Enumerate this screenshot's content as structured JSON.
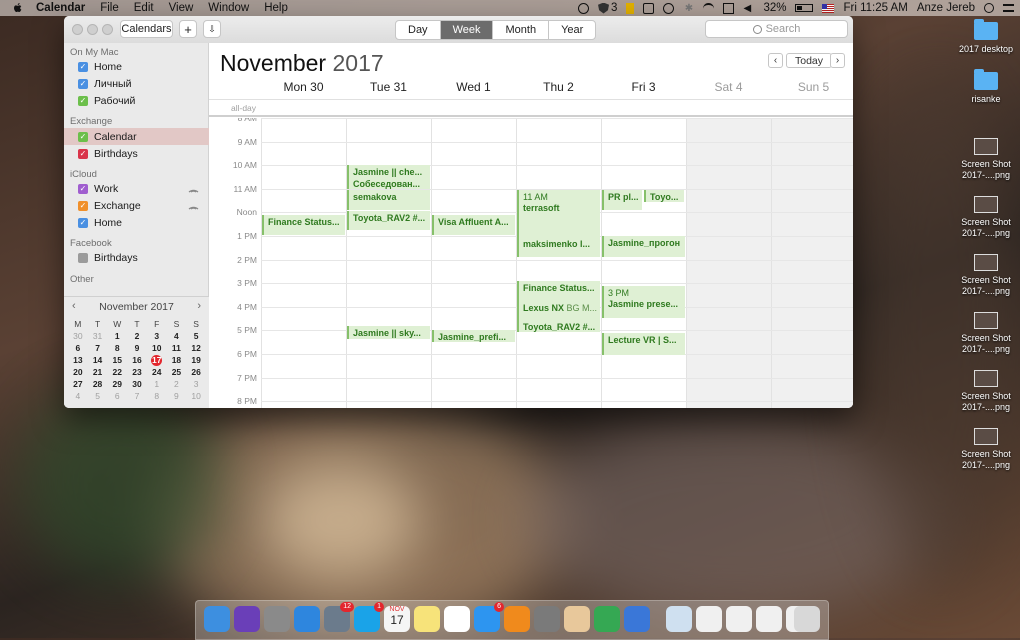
{
  "menubar": {
    "app": "Calendar",
    "items": [
      "File",
      "Edit",
      "View",
      "Window",
      "Help"
    ],
    "badge_count": "3",
    "battery": "32%",
    "clock": "Fri 11:25 AM",
    "user": "Anze Jereb"
  },
  "toolbar": {
    "calendars_label": "Calendars",
    "add_label": "+",
    "views": [
      "Day",
      "Week",
      "Month",
      "Year"
    ],
    "active_view": "Week",
    "search_placeholder": "Search",
    "today_label": "Today"
  },
  "sidebar": {
    "sections": [
      {
        "title": "On My Mac",
        "items": [
          {
            "label": "Home",
            "color": "#4a90e2"
          },
          {
            "label": "Личный",
            "color": "#4a90e2"
          },
          {
            "label": "Рабочий",
            "color": "#6cbf4b"
          }
        ]
      },
      {
        "title": "Exchange",
        "items": [
          {
            "label": "Calendar",
            "color": "#6cbf4b"
          },
          {
            "label": "Birthdays",
            "color": "#d9344a"
          }
        ]
      },
      {
        "title": "iCloud",
        "items": [
          {
            "label": "Work",
            "color": "#a05ecf"
          },
          {
            "label": "Exchange",
            "color": "#f0902b"
          },
          {
            "label": "Home",
            "color": "#4a90e2"
          }
        ]
      },
      {
        "title": "Facebook",
        "items": [
          {
            "label": "Birthdays",
            "color": "#9b9b9b"
          }
        ]
      },
      {
        "title": "Other",
        "items": []
      }
    ]
  },
  "minical": {
    "title": "November 2017",
    "dow": [
      "M",
      "T",
      "W",
      "T",
      "F",
      "S",
      "S"
    ],
    "weeks": [
      [
        "30",
        "31",
        "1",
        "2",
        "3",
        "4",
        "5"
      ],
      [
        "6",
        "7",
        "8",
        "9",
        "10",
        "11",
        "12"
      ],
      [
        "13",
        "14",
        "15",
        "16",
        "17",
        "18",
        "19"
      ],
      [
        "20",
        "21",
        "22",
        "23",
        "24",
        "25",
        "26"
      ],
      [
        "27",
        "28",
        "29",
        "30",
        "1",
        "2",
        "3"
      ],
      [
        "4",
        "5",
        "6",
        "7",
        "8",
        "9",
        "10"
      ]
    ],
    "today": "17"
  },
  "calendar": {
    "month": "November",
    "year": "2017",
    "days": [
      "Mon 30",
      "Tue 31",
      "Wed 1",
      "Thu 2",
      "Fri 3",
      "Sat 4",
      "Sun 5"
    ],
    "allday_label": "all-day",
    "hours": [
      "8 AM",
      "9 AM",
      "10 AM",
      "11 AM",
      "Noon",
      "1 PM",
      "2 PM",
      "3 PM",
      "4 PM",
      "5 PM",
      "6 PM",
      "7 PM",
      "8 PM"
    ],
    "events": [
      {
        "day": 0,
        "start": 12.1,
        "end": 13.0,
        "title": "Finance Status..."
      },
      {
        "day": 1,
        "start": 10.0,
        "end": 10.55,
        "title": "Jasmine || che..."
      },
      {
        "day": 1,
        "start": 10.5,
        "end": 11.05,
        "title": "Собеседован..."
      },
      {
        "day": 1,
        "start": 11.05,
        "end": 11.95,
        "title": "semakova"
      },
      {
        "day": 1,
        "start": 11.95,
        "end": 12.8,
        "title": "Toyota_RAV2 #..."
      },
      {
        "day": 1,
        "start": 16.8,
        "end": 17.4,
        "title": "Jasmine || sky..."
      },
      {
        "day": 2,
        "start": 12.1,
        "end": 13.0,
        "title": "Visa Affluent A..."
      },
      {
        "day": 2,
        "start": 17.0,
        "end": 17.55,
        "title": "Jasmine_prefi..."
      },
      {
        "day": 3,
        "start": 11.05,
        "end": 13.95,
        "title": "terrasoft",
        "time": "11 AM"
      },
      {
        "day": 3,
        "start": 13.05,
        "end": 13.95,
        "title": "maksimenko l..."
      },
      {
        "day": 3,
        "start": 14.9,
        "end": 15.9,
        "title": "Finance Status..."
      },
      {
        "day": 3,
        "start": 15.75,
        "end": 16.6,
        "title": "Lexus NX",
        "loc": "BG M..."
      },
      {
        "day": 3,
        "start": 16.55,
        "end": 17.1,
        "title": "Toyota_RAV2 #..."
      },
      {
        "day": 4,
        "start": 11.05,
        "end": 11.95,
        "title": "PR pl...",
        "half": "left"
      },
      {
        "day": 4,
        "start": 11.05,
        "end": 11.55,
        "title": "Toyo...",
        "half": "right"
      },
      {
        "day": 4,
        "start": 13.0,
        "end": 13.95,
        "title": "Jasmine_прогон"
      },
      {
        "day": 4,
        "start": 15.1,
        "end": 16.5,
        "title": "Jasmine prese...",
        "time": "3 PM"
      },
      {
        "day": 4,
        "start": 17.1,
        "end": 18.1,
        "title": "Lecture VR | S..."
      }
    ]
  },
  "desktop": [
    {
      "label": "2017 desktop",
      "kind": "folder"
    },
    {
      "label": "risanke",
      "kind": "folder"
    },
    {
      "label": "Screen Shot 2017-....png",
      "kind": "shot"
    },
    {
      "label": "Screen Shot 2017-....png",
      "kind": "shot"
    },
    {
      "label": "Screen Shot 2017-....png",
      "kind": "shot"
    },
    {
      "label": "Screen Shot 2017-....png",
      "kind": "shot"
    },
    {
      "label": "Screen Shot 2017-....png",
      "kind": "shot"
    },
    {
      "label": "Screen Shot 2017-....png",
      "kind": "shot"
    }
  ],
  "dock": {
    "apps": [
      {
        "name": "finder-icon",
        "color": "#3d8fe0"
      },
      {
        "name": "siri-icon",
        "color": "#6a3fb8"
      },
      {
        "name": "launchpad-icon",
        "color": "#8a8a8a"
      },
      {
        "name": "safari-icon",
        "color": "#2e86de"
      },
      {
        "name": "preview-icon",
        "color": "#6b7b8c",
        "badge": "12"
      },
      {
        "name": "skype-icon",
        "color": "#1aa3e8",
        "badge": "1"
      },
      {
        "name": "calendar-icon",
        "color": "#f5f5f5"
      },
      {
        "name": "notes-icon",
        "color": "#f7e37a"
      },
      {
        "name": "reminders-icon",
        "color": "#ffffff"
      },
      {
        "name": "appstore-icon",
        "color": "#2d95f0",
        "badge": "6"
      },
      {
        "name": "vlc-icon",
        "color": "#f08a1c"
      },
      {
        "name": "system-preferences-icon",
        "color": "#7a7a7a"
      },
      {
        "name": "sketch-icon",
        "color": "#e8c89b"
      },
      {
        "name": "numbers-icon",
        "color": "#35a853"
      },
      {
        "name": "keynote-icon",
        "color": "#3a77d8"
      },
      {
        "name": "downloads-stack-icon",
        "color": "#cfe0f0"
      },
      {
        "name": "document-stack-icon",
        "color": "#f0f0f0"
      },
      {
        "name": "document-stack-icon-2",
        "color": "#f0f0f0"
      },
      {
        "name": "document-stack-icon-3",
        "color": "#f0f0f0"
      },
      {
        "name": "document-stack-icon-4",
        "color": "#f0f0f0"
      },
      {
        "name": "trash-icon",
        "color": "#d8d8d8"
      }
    ],
    "calendar_date": "17",
    "calendar_month": "NOV"
  }
}
